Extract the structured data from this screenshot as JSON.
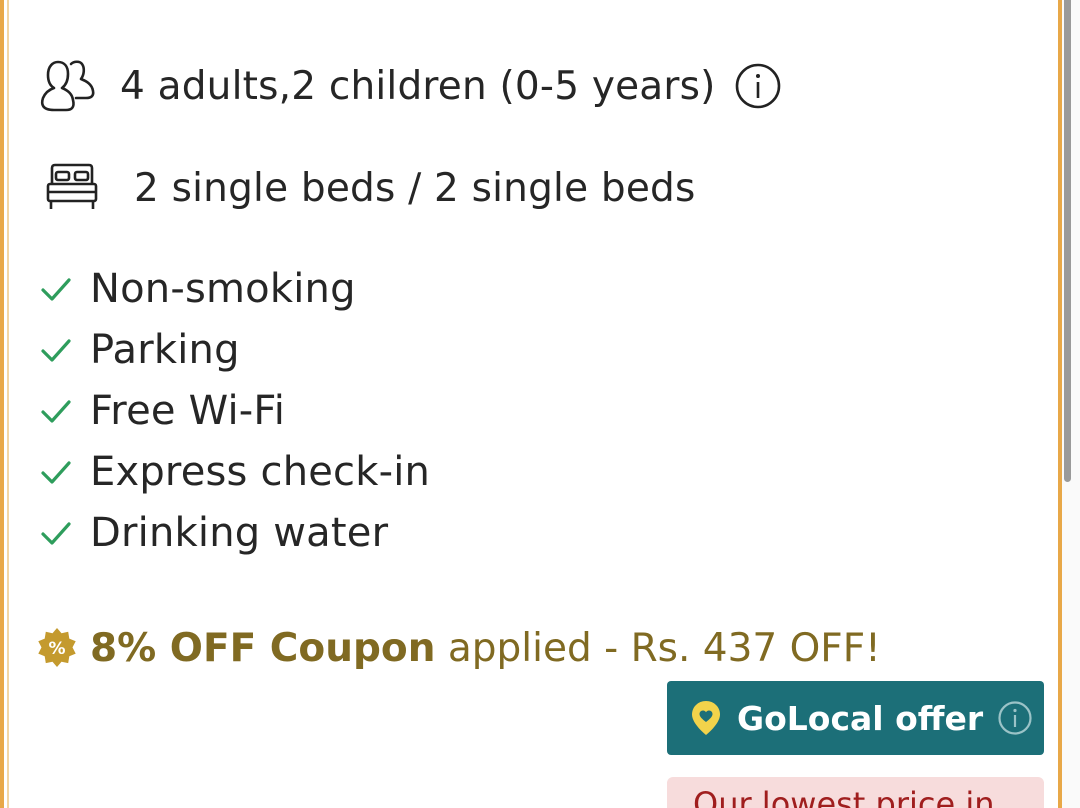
{
  "room": {
    "guests": "4 adults,2 children (0-5 years)",
    "beds": "2 single beds / 2 single beds",
    "features": [
      "Non-smoking",
      "Parking",
      "Free Wi-Fi",
      "Express check-in",
      "Drinking water"
    ]
  },
  "coupon": {
    "badge_symbol": "%",
    "highlight": "8% OFF Coupon",
    "rest": " applied - Rs. 437 OFF!"
  },
  "golocal": {
    "label": "GoLocal offer"
  },
  "lowest_price": {
    "text": "Our lowest price in"
  },
  "icons": {
    "guests": "people-icon",
    "beds": "bed-icon",
    "info": "info-icon",
    "feature": "check-icon",
    "coupon": "discount-badge-icon",
    "golocal": "location-pin-icon"
  },
  "colors": {
    "card_border": "#e8a848",
    "check": "#2e9d5c",
    "coupon_text": "#806a22",
    "coupon_badge": "#c49a2e",
    "golocal_bg": "#1c6f78",
    "pin": "#f2d34b",
    "lowest_bg": "#f7dcdc",
    "lowest_text": "#a01e1e"
  }
}
